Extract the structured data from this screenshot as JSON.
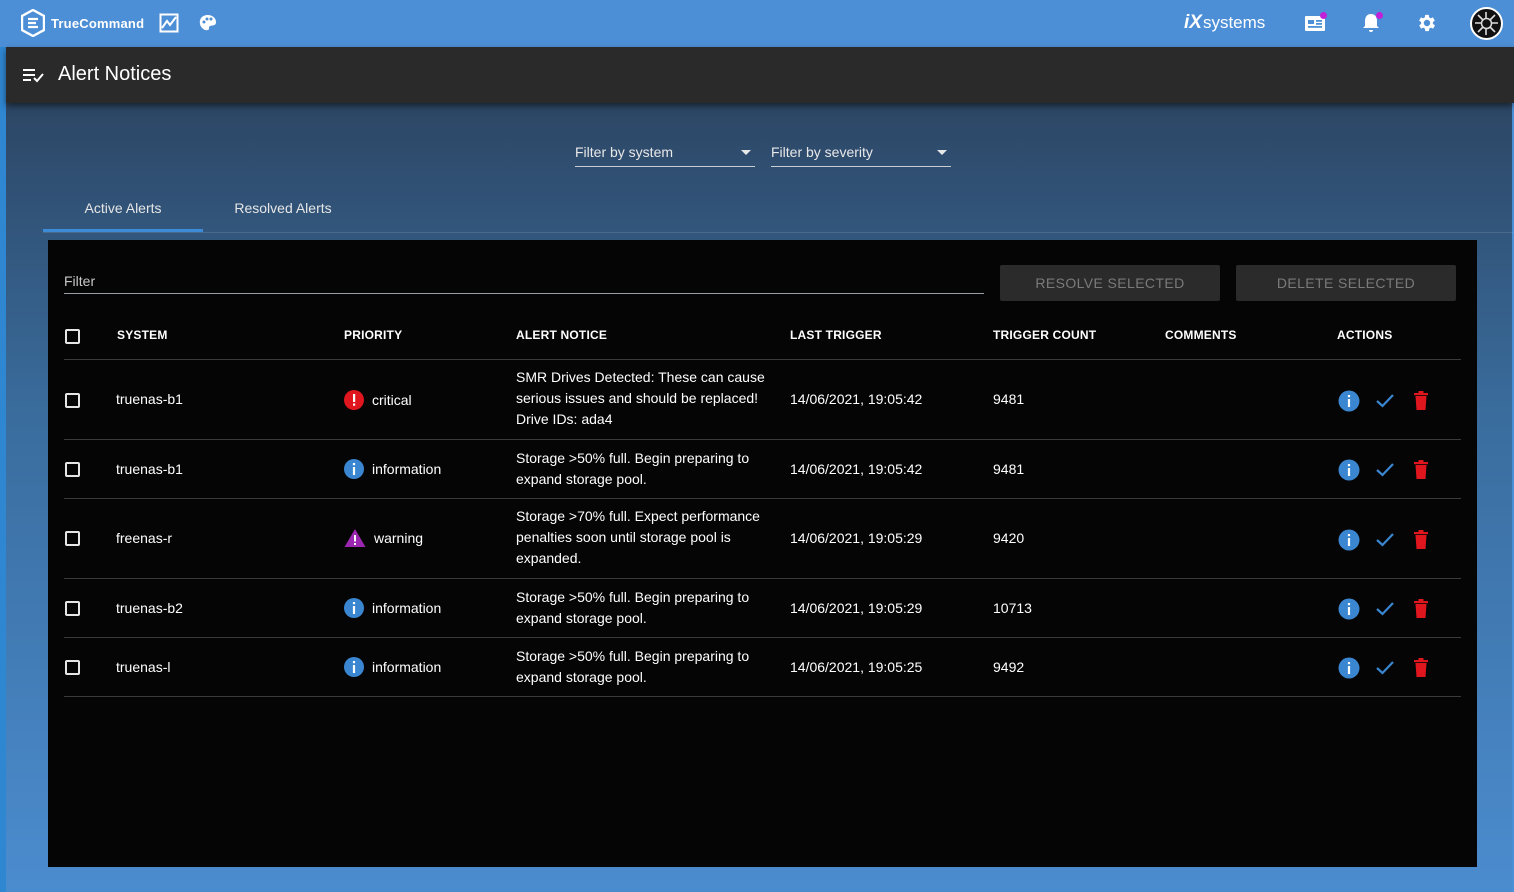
{
  "app": {
    "brand": "TrueCommand",
    "vendor_logo_prefix": "iX",
    "vendor_logo_text": "systems"
  },
  "page": {
    "title": "Alert Notices"
  },
  "filters": {
    "system_label": "Filter by system",
    "severity_label": "Filter by severity"
  },
  "tabs": [
    {
      "label": "Active Alerts",
      "active": true
    },
    {
      "label": "Resolved Alerts",
      "active": false
    }
  ],
  "table": {
    "filter_placeholder": "Filter",
    "resolve_label": "RESOLVE SELECTED",
    "delete_label": "DELETE SELECTED",
    "columns": [
      "SYSTEM",
      "PRIORITY",
      "ALERT NOTICE",
      "LAST TRIGGER",
      "TRIGGER COUNT",
      "COMMENTS",
      "ACTIONS"
    ],
    "rows": [
      {
        "system": "truenas-b1",
        "priority": "critical",
        "notice": "SMR Drives Detected: These can cause serious issues and should be replaced! Drive IDs: ada4",
        "last_trigger": "14/06/2021, 19:05:42",
        "count": "9481",
        "comments": ""
      },
      {
        "system": "truenas-b1",
        "priority": "information",
        "notice": "Storage >50% full. Begin preparing to expand storage pool.",
        "last_trigger": "14/06/2021, 19:05:42",
        "count": "9481",
        "comments": ""
      },
      {
        "system": "freenas-r",
        "priority": "warning",
        "notice": "Storage >70% full. Expect performance penalties soon until storage pool is expanded.",
        "last_trigger": "14/06/2021, 19:05:29",
        "count": "9420",
        "comments": ""
      },
      {
        "system": "truenas-b2",
        "priority": "information",
        "notice": "Storage >50% full. Begin preparing to expand storage pool.",
        "last_trigger": "14/06/2021, 19:05:29",
        "count": "10713",
        "comments": ""
      },
      {
        "system": "truenas-l",
        "priority": "information",
        "notice": "Storage >50% full. Begin preparing to expand storage pool.",
        "last_trigger": "14/06/2021, 19:05:25",
        "count": "9492",
        "comments": ""
      }
    ]
  },
  "colors": {
    "topbar": "#4d8fd6",
    "critical": "#e0161e",
    "information": "#3b86d1",
    "warning": "#9b27b0",
    "delete": "#e0161e",
    "accent": "#3d8bd6"
  },
  "icons": {
    "brand": "truecommand-logo-icon",
    "dashboard": "chart-icon",
    "theme": "palette-icon",
    "news": "news-icon",
    "notifications": "bell-icon",
    "settings": "gear-icon",
    "menu": "menu-check-icon",
    "critical": "error-icon",
    "information": "info-icon",
    "warning": "warning-triangle-icon",
    "row_info": "info-icon",
    "row_resolve": "check-icon",
    "row_delete": "trash-icon"
  }
}
